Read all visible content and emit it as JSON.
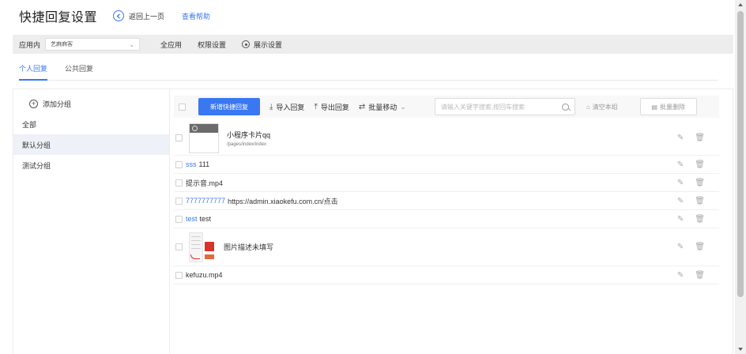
{
  "header": {
    "title": "快捷回复设置",
    "back_label": "返回上一页",
    "help_label": "查看帮助"
  },
  "appbar": {
    "app_label": "应用内",
    "app_value": "艺麻麻客",
    "menu": [
      {
        "label": "全应用"
      },
      {
        "label": "权限设置"
      },
      {
        "label": "展示设置"
      }
    ]
  },
  "tabs": [
    {
      "label": "个人回复",
      "active": true
    },
    {
      "label": "公共回复",
      "active": false
    }
  ],
  "sidebar": {
    "add_label": "添加分组",
    "items": [
      {
        "label": "全部"
      },
      {
        "label": "默认分组",
        "selected": true
      },
      {
        "label": "测试分组"
      }
    ]
  },
  "toolbar": {
    "new_label": "新增快捷回复",
    "import_label": "导入回复",
    "export_label": "导出回复",
    "move_label": "批量移动",
    "search_placeholder": "请输入关键字搜索,按回车搜索",
    "clear_label": "清空本组",
    "batch_delete_label": "批量删除"
  },
  "replies": {
    "miniprogram": {
      "title": "小程序卡片qq",
      "path": "/pages/index/index"
    },
    "r1": {
      "keyword": "sss",
      "text": "111"
    },
    "r2": {
      "keyword": "",
      "text": "提示音.mp4"
    },
    "r3": {
      "keyword": "7777777777",
      "text": "https://admin.xiaokefu.com.cn/点击"
    },
    "r4": {
      "keyword": "test",
      "text": "test"
    },
    "image": {
      "text": "图片描述未填写"
    },
    "r5": {
      "keyword": "",
      "text": "kefuzu.mp4"
    }
  },
  "colors": {
    "accent": "#3a78f2",
    "selected_bg": "#eef1f7",
    "bar_bg": "#ededed"
  }
}
